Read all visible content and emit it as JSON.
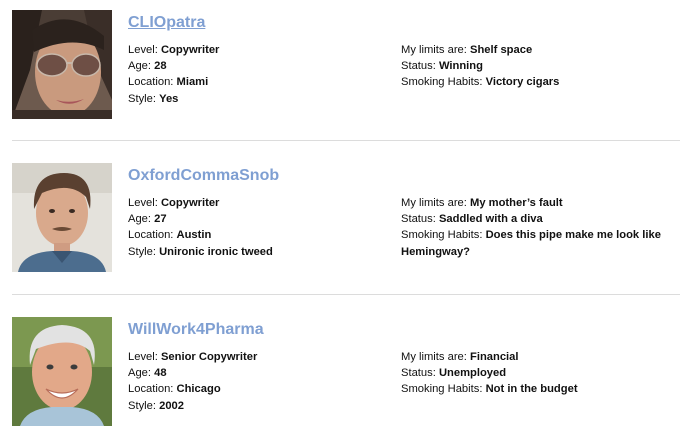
{
  "profiles": [
    {
      "username": "CLIOpatra",
      "photo_icon": "woman-sunglasses-portrait",
      "left": [
        {
          "label": "Level:",
          "value": "Copywriter"
        },
        {
          "label": "Age:",
          "value": "28"
        },
        {
          "label": "Location:",
          "value": "Miami"
        },
        {
          "label": "Style:",
          "value": "Yes"
        }
      ],
      "right": [
        {
          "label": "My limits are:",
          "value": "Shelf space"
        },
        {
          "label": "Status:",
          "value": "Winning"
        },
        {
          "label": "Smoking Habits:",
          "value": "Victory cigars"
        }
      ]
    },
    {
      "username": "OxfordCommaSnob",
      "photo_icon": "man-mustache-portrait",
      "left": [
        {
          "label": "Level:",
          "value": "Copywriter"
        },
        {
          "label": "Age:",
          "value": "27"
        },
        {
          "label": "Location:",
          "value": "Austin"
        },
        {
          "label": "Style:",
          "value": "Unironic ironic tweed"
        }
      ],
      "right": [
        {
          "label": "My limits are:",
          "value": "My mother’s fault"
        },
        {
          "label": "Status:",
          "value": "Saddled with a diva"
        },
        {
          "label": "Smoking Habits:",
          "value": "Does this pipe make me look like Hemingway?"
        }
      ]
    },
    {
      "username": "WillWork4Pharma",
      "photo_icon": "smiling-gray-haired-man-portrait",
      "left": [
        {
          "label": "Level:",
          "value": "Senior Copywriter"
        },
        {
          "label": "Age:",
          "value": "48"
        },
        {
          "label": "Location:",
          "value": "Chicago"
        },
        {
          "label": "Style:",
          "value": "2002"
        }
      ],
      "right": [
        {
          "label": "My limits are:",
          "value": "Financial"
        },
        {
          "label": "Status:",
          "value": "Unemployed"
        },
        {
          "label": "Smoking Habits:",
          "value": "Not in the budget"
        }
      ]
    }
  ],
  "colors": {
    "username_link": "#7f9fd2",
    "divider": "#dcdcdc"
  }
}
